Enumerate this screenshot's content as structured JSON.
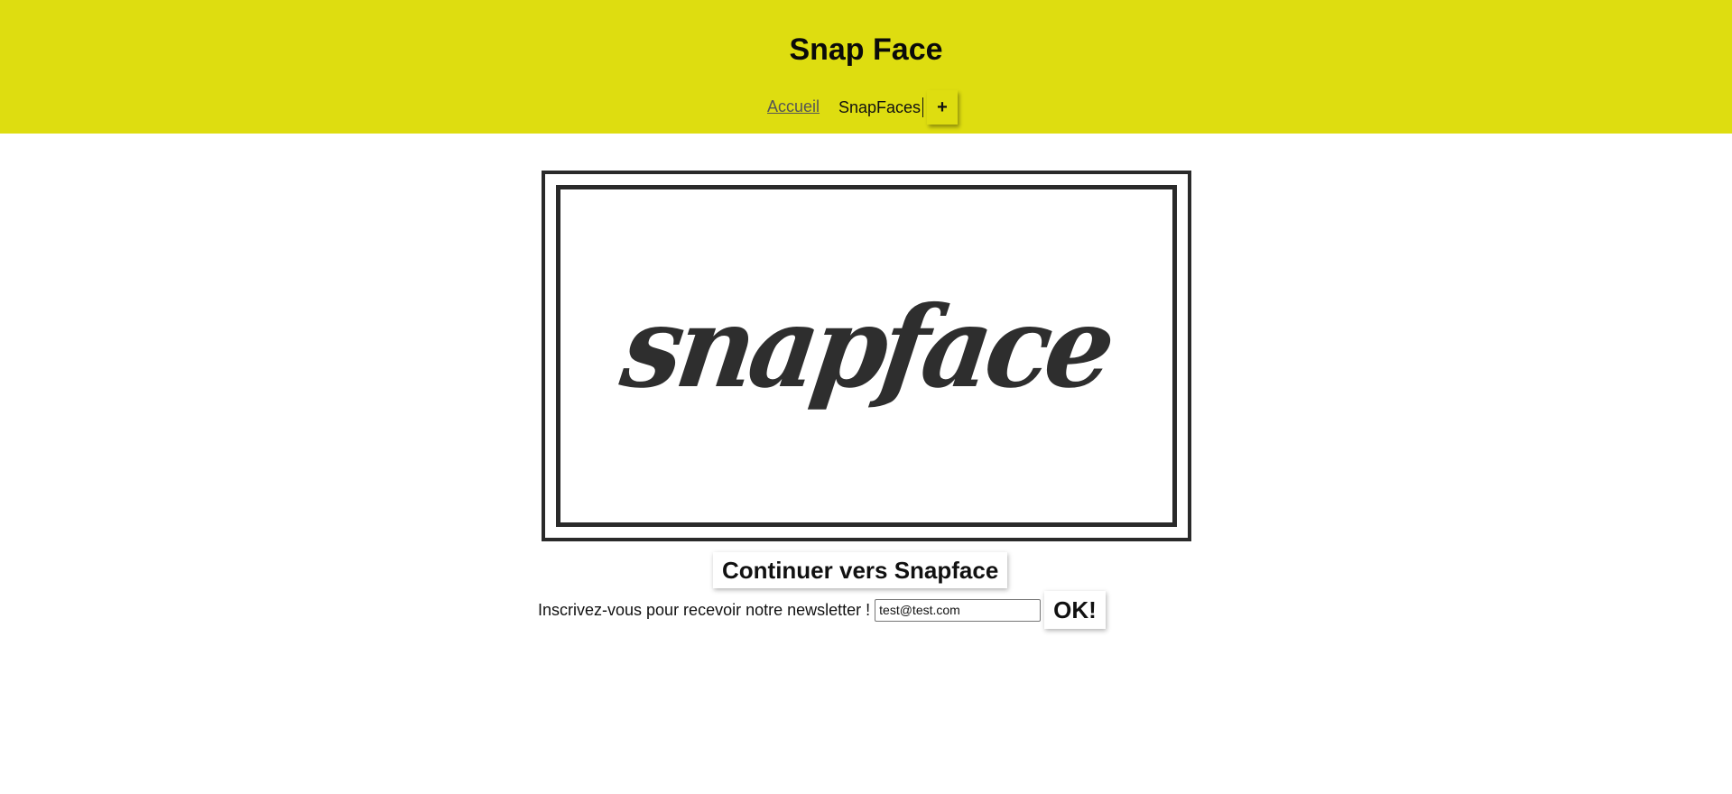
{
  "header": {
    "title": "Snap Face",
    "background_color": "#dedd10",
    "nav": {
      "home_label": "Accueil",
      "snapfaces_label": "SnapFaces",
      "add_label": "+"
    }
  },
  "hero": {
    "logo_text": "snapface"
  },
  "main": {
    "continue_label": "Continuer vers Snapface",
    "newsletter": {
      "label": "Inscrivez-vous pour recevoir notre newsletter !",
      "email_value": "test@test.com",
      "submit_label": "OK!"
    }
  }
}
